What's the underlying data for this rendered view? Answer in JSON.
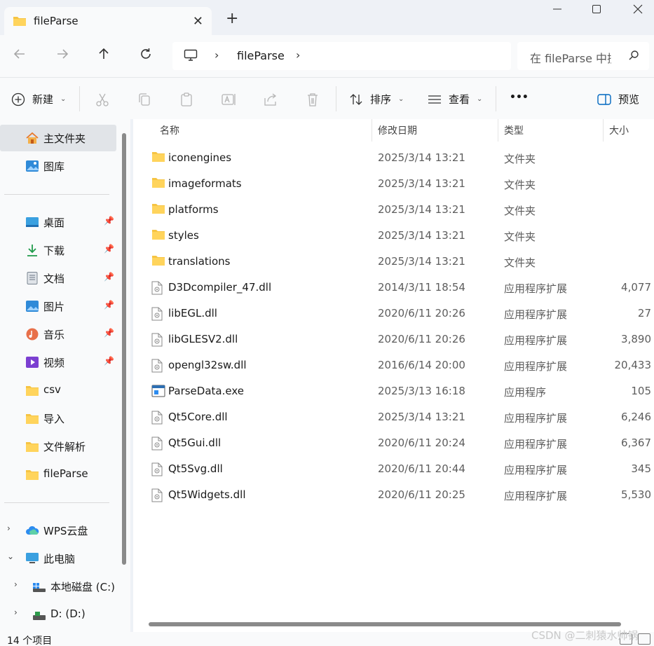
{
  "tab": {
    "title": "fileParse"
  },
  "address": {
    "crumb": "fileParse"
  },
  "search": {
    "placeholder": "在 fileParse 中搜索"
  },
  "toolbar": {
    "new_label": "新建",
    "sort_label": "排序",
    "view_label": "查看",
    "more_label": "•••",
    "preview_label": "预览"
  },
  "sidebar": {
    "home": "主文件夹",
    "gallery": "图库",
    "quick": [
      {
        "label": "桌面",
        "icon": "desktop-icon"
      },
      {
        "label": "下载",
        "icon": "download-icon"
      },
      {
        "label": "文档",
        "icon": "document-icon"
      },
      {
        "label": "图片",
        "icon": "pictures-icon"
      },
      {
        "label": "音乐",
        "icon": "music-icon"
      },
      {
        "label": "视频",
        "icon": "video-icon"
      }
    ],
    "folders": [
      "csv",
      "导入",
      "文件解析",
      "fileParse"
    ],
    "wps": "WPS云盘",
    "thispc": "此电脑",
    "drive_c": "本地磁盘 (C:)",
    "drive_d": "D: (D:)"
  },
  "columns": {
    "name": "名称",
    "date": "修改日期",
    "type": "类型",
    "size": "大小"
  },
  "files": [
    {
      "name": "iconengines",
      "date": "2025/3/14 13:21",
      "type": "文件夹",
      "size": "",
      "kind": "folder"
    },
    {
      "name": "imageformats",
      "date": "2025/3/14 13:21",
      "type": "文件夹",
      "size": "",
      "kind": "folder"
    },
    {
      "name": "platforms",
      "date": "2025/3/14 13:21",
      "type": "文件夹",
      "size": "",
      "kind": "folder"
    },
    {
      "name": "styles",
      "date": "2025/3/14 13:21",
      "type": "文件夹",
      "size": "",
      "kind": "folder"
    },
    {
      "name": "translations",
      "date": "2025/3/14 13:21",
      "type": "文件夹",
      "size": "",
      "kind": "folder"
    },
    {
      "name": "D3Dcompiler_47.dll",
      "date": "2014/3/11 18:54",
      "type": "应用程序扩展",
      "size": "4,077",
      "kind": "dll"
    },
    {
      "name": "libEGL.dll",
      "date": "2020/6/11 20:26",
      "type": "应用程序扩展",
      "size": "27",
      "kind": "dll"
    },
    {
      "name": "libGLESV2.dll",
      "date": "2020/6/11 20:26",
      "type": "应用程序扩展",
      "size": "3,890",
      "kind": "dll"
    },
    {
      "name": "opengl32sw.dll",
      "date": "2016/6/14 20:00",
      "type": "应用程序扩展",
      "size": "20,433",
      "kind": "dll"
    },
    {
      "name": "ParseData.exe",
      "date": "2025/3/13 16:18",
      "type": "应用程序",
      "size": "105",
      "kind": "exe"
    },
    {
      "name": "Qt5Core.dll",
      "date": "2025/3/14 13:21",
      "type": "应用程序扩展",
      "size": "6,246",
      "kind": "dll"
    },
    {
      "name": "Qt5Gui.dll",
      "date": "2020/6/11 20:24",
      "type": "应用程序扩展",
      "size": "6,367",
      "kind": "dll"
    },
    {
      "name": "Qt5Svg.dll",
      "date": "2020/6/11 20:44",
      "type": "应用程序扩展",
      "size": "345",
      "kind": "dll"
    },
    {
      "name": "Qt5Widgets.dll",
      "date": "2020/6/11 20:25",
      "type": "应用程序扩展",
      "size": "5,530",
      "kind": "dll"
    }
  ],
  "status": {
    "count": "14 个项目"
  },
  "watermark": "CSDN @二刺猿水帅锅",
  "colors": {
    "folder": "#f6c443",
    "accent": "#0067c0"
  }
}
